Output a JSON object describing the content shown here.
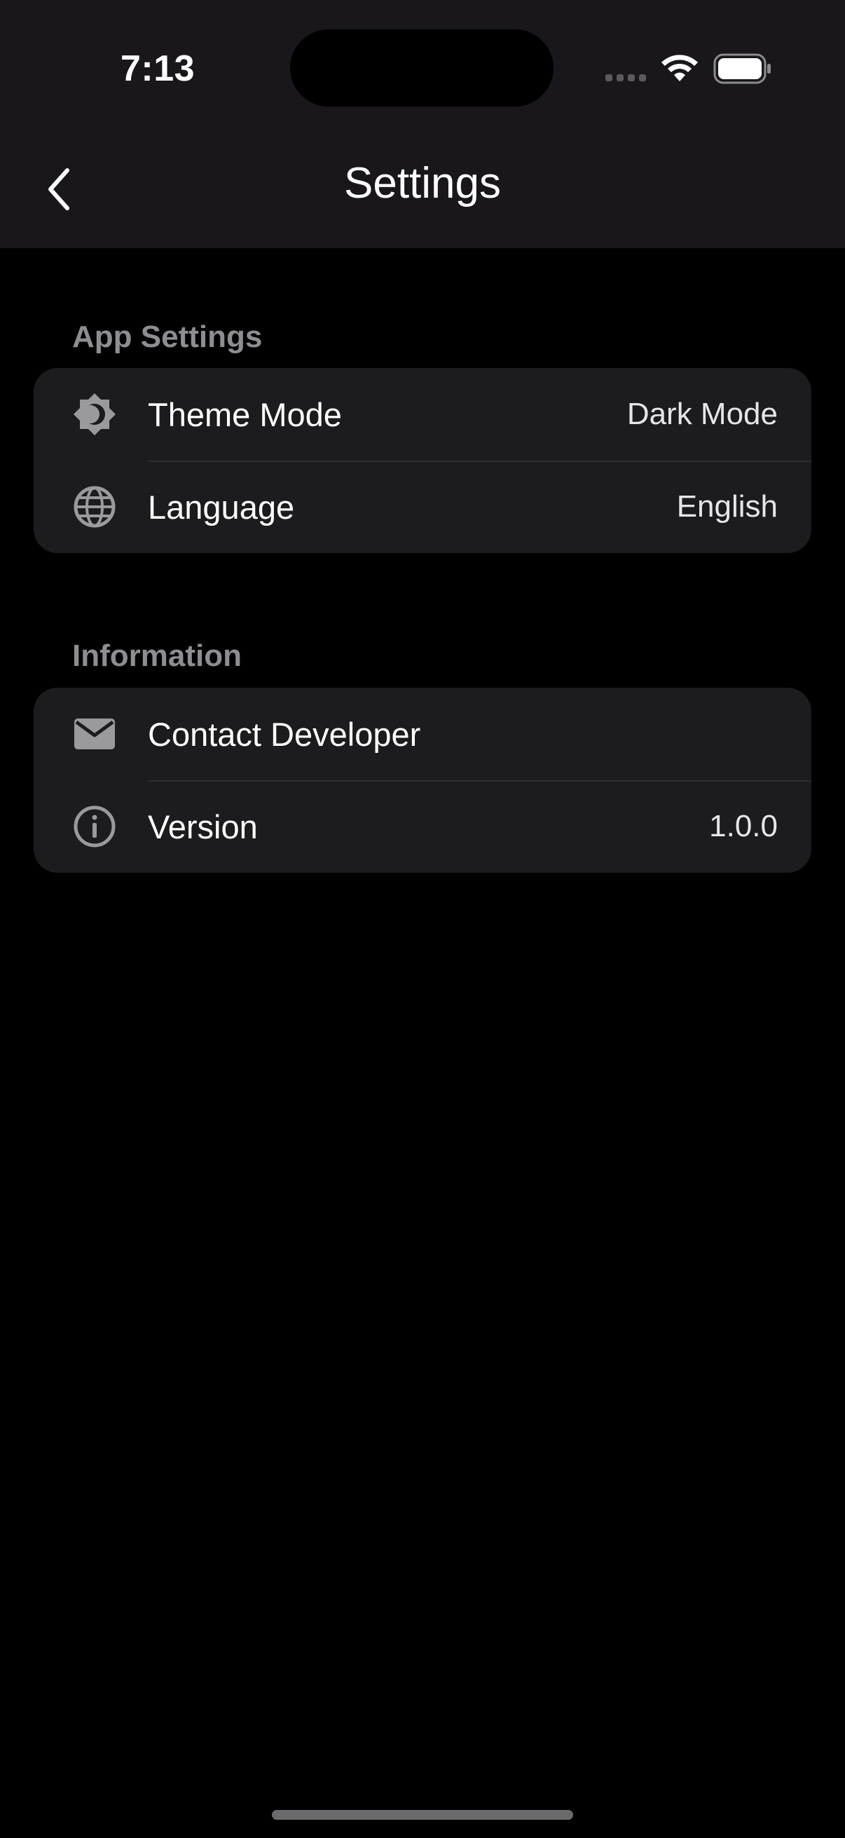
{
  "status_bar": {
    "time": "7:13"
  },
  "nav": {
    "title": "Settings",
    "back_icon": "chevron-left-icon"
  },
  "sections": [
    {
      "header": "App Settings",
      "rows": [
        {
          "icon": "theme-mode-icon",
          "label": "Theme Mode",
          "value": "Dark Mode"
        },
        {
          "icon": "globe-icon",
          "label": "Language",
          "value": "English"
        }
      ]
    },
    {
      "header": "Information",
      "rows": [
        {
          "icon": "mail-icon",
          "label": "Contact Developer",
          "value": ""
        },
        {
          "icon": "info-icon",
          "label": "Version",
          "value": "1.0.0"
        }
      ]
    }
  ],
  "colors": {
    "background": "#000000",
    "topbar": "#1a171c",
    "card": "#1c1c1e",
    "section_header": "#8e8d92",
    "icon": "#9a999e"
  }
}
